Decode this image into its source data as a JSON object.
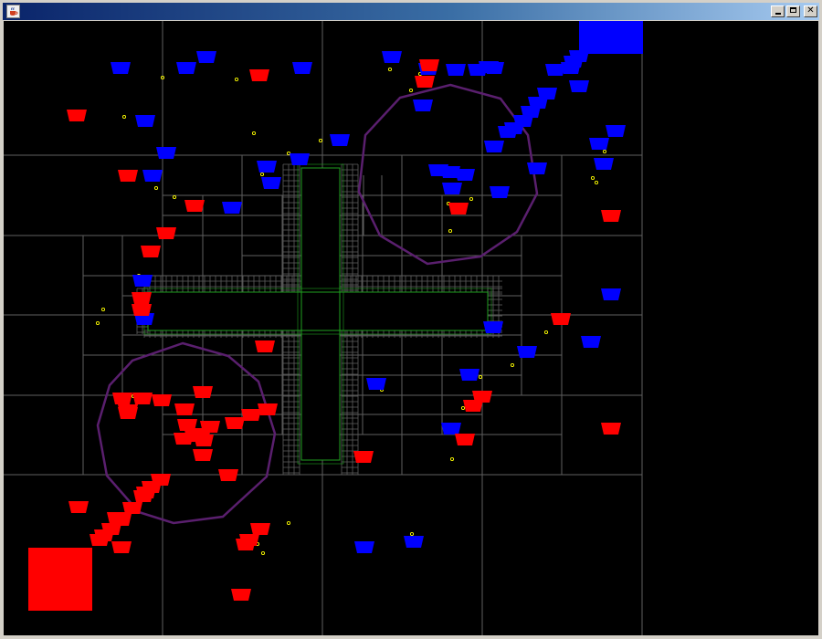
{
  "window": {
    "title": "",
    "app_icon": "java-cup-icon",
    "controls": [
      "minimize-icon",
      "maximize-icon",
      "close-icon"
    ]
  },
  "colors": {
    "background": "#000000",
    "grid_line": "#5f5f5f",
    "team_red": "#ff0000",
    "team_blue": "#0000ff",
    "obstacle_outline": "#1fa11f",
    "zone_outline": "#5a1f6e",
    "resource_dot": "#ffff00"
  },
  "scene": {
    "team_red": {
      "unit_icon": "bucket-icon",
      "units_visible": 53,
      "base": "red-base"
    },
    "team_blue": {
      "unit_icon": "bucket-icon",
      "units_visible": 51,
      "base": "blue-base"
    },
    "obstacle": "cross-shaped-wall",
    "capture_zones": 2,
    "resource_dots_visible": 34
  }
}
